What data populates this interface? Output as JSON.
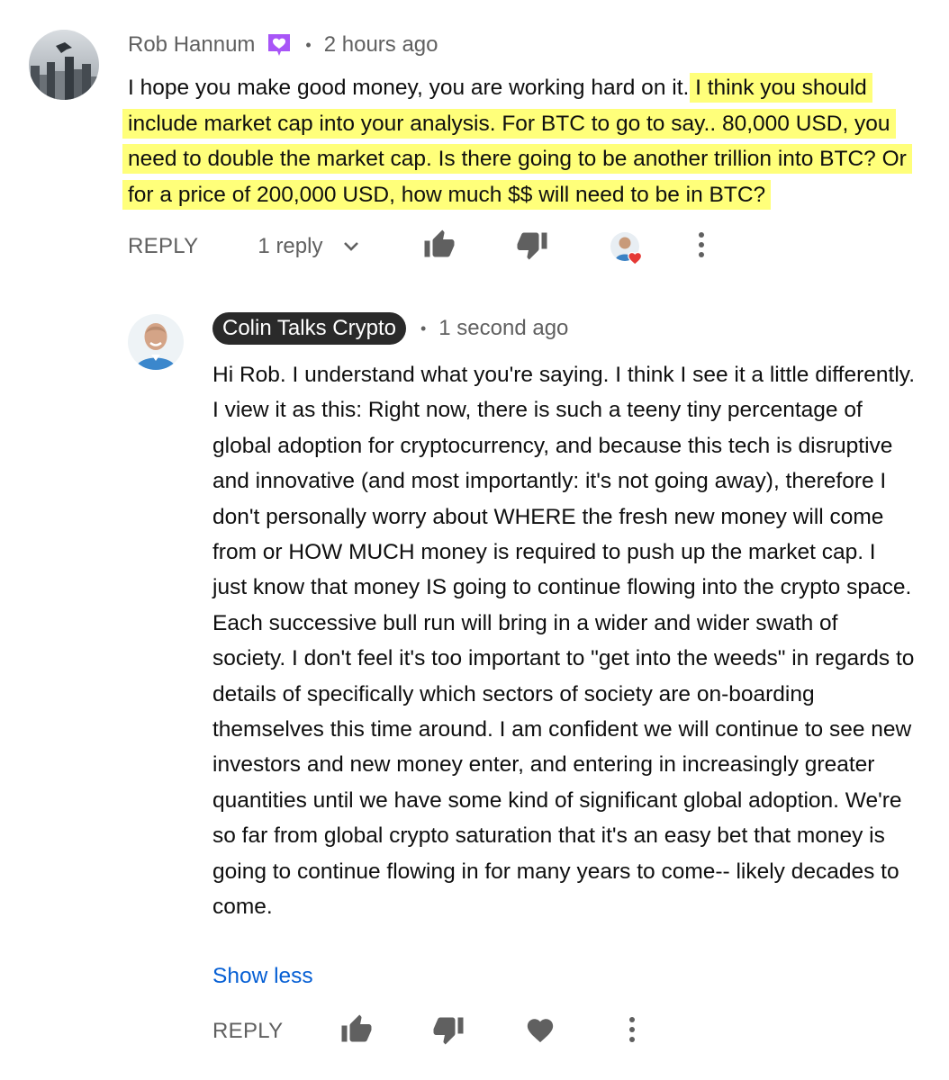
{
  "comment": {
    "author": "Rob Hannum",
    "timestamp": "2 hours ago",
    "text_plain": "I hope you make good money, you are working hard on it.",
    "text_highlighted": "I think you should include market cap into your analysis.  For BTC to go to say.. 80,000 USD, you need to double the market cap.  Is there going to be another trillion into BTC?  Or for a price of 200,000 USD, how much $$ will need to be in BTC?",
    "highlight_color": "#ffff7a",
    "icons": [
      "member-badge-icon",
      "thumbs-up-icon",
      "thumbs-down-icon",
      "creator-heart-icon",
      "more-vert-icon",
      "chevron-down-icon"
    ],
    "actions": {
      "reply_label": "REPLY",
      "replies_label": "1 reply"
    }
  },
  "reply": {
    "author": "Colin Talks Crypto",
    "timestamp": "1 second ago",
    "text": "Hi Rob. I understand what you're saying. I think I see it a little differently. I view it as this: Right now, there is such a teeny tiny percentage of global adoption for cryptocurrency, and because this tech is disruptive and innovative (and most importantly: it's not going away), therefore I don't personally worry about WHERE the fresh new money will come from or HOW MUCH money is required to push up the market cap. I just know that money IS going to continue flowing into the crypto space. Each successive bull run will bring in a wider and wider swath of society. I don't feel it's too important to \"get into the weeds\" in regards to details of specifically which sectors of society are on-boarding themselves this time around. I am confident we will continue to see new investors and new money enter, and entering in increasingly greater quantities until we have some kind of significant global adoption. We're so far from global crypto saturation that it's an easy bet that money is going to continue flowing in for many years to come-- likely decades to come.",
    "show_less_label": "Show less",
    "icons": [
      "thumbs-up-icon",
      "thumbs-down-icon",
      "heart-icon",
      "more-vert-icon"
    ],
    "actions": {
      "reply_label": "REPLY"
    }
  },
  "colors": {
    "owner_chip_bg": "#2a2a2a",
    "link_blue": "#065fd4",
    "muted_text": "#606060",
    "heart_red": "#e53935",
    "member_badge_purple": "#a855f7"
  }
}
